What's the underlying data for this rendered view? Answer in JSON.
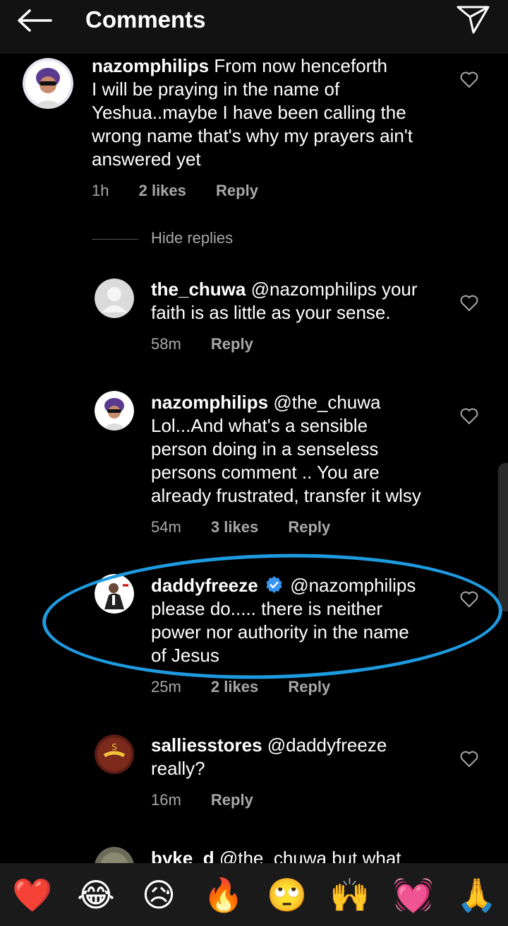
{
  "header": {
    "title": "Comments",
    "back_icon": "arrow-left-icon",
    "send_icon": "send-icon"
  },
  "comments": [
    {
      "user": "nazomphilips",
      "lines": [
        " From now henceforth",
        "I will be praying in the name of",
        "Yeshua..maybe I have been calling the",
        "wrong name that's why my prayers ain't",
        "answered yet"
      ],
      "time": "1h",
      "likes": "2 likes",
      "reply": "Reply"
    },
    {
      "user": "the_chuwa",
      "lines": [
        " @nazomphilips your",
        "faith is as little as your sense."
      ],
      "time": "58m",
      "likes": "",
      "reply": "Reply"
    },
    {
      "user": "nazomphilips",
      "lines": [
        " @the_chuwa",
        "Lol...And what's a sensible",
        "person doing in a senseless",
        "persons comment .. You are",
        "already frustrated, transfer it wlsy"
      ],
      "time": "54m",
      "likes": "3 likes",
      "reply": "Reply"
    },
    {
      "user": "daddyfreeze",
      "lines": [
        "@nazomphilips",
        "please do..... there is neither",
        "power nor authority in the name",
        "of Jesus"
      ],
      "time": "25m",
      "likes": "2 likes",
      "reply": "Reply"
    },
    {
      "user": "salliesstores",
      "lines": [
        " @daddyfreeze",
        "really?"
      ],
      "time": "16m",
      "likes": "",
      "reply": "Reply"
    },
    {
      "user": "byke_d",
      "lines": [
        " @the_chuwa but what"
      ]
    }
  ],
  "hide_replies": "Hide replies",
  "reactions": [
    "❤️",
    "😂",
    "😥",
    "🔥",
    "🙄",
    "🙌",
    "💓",
    "🙏"
  ]
}
